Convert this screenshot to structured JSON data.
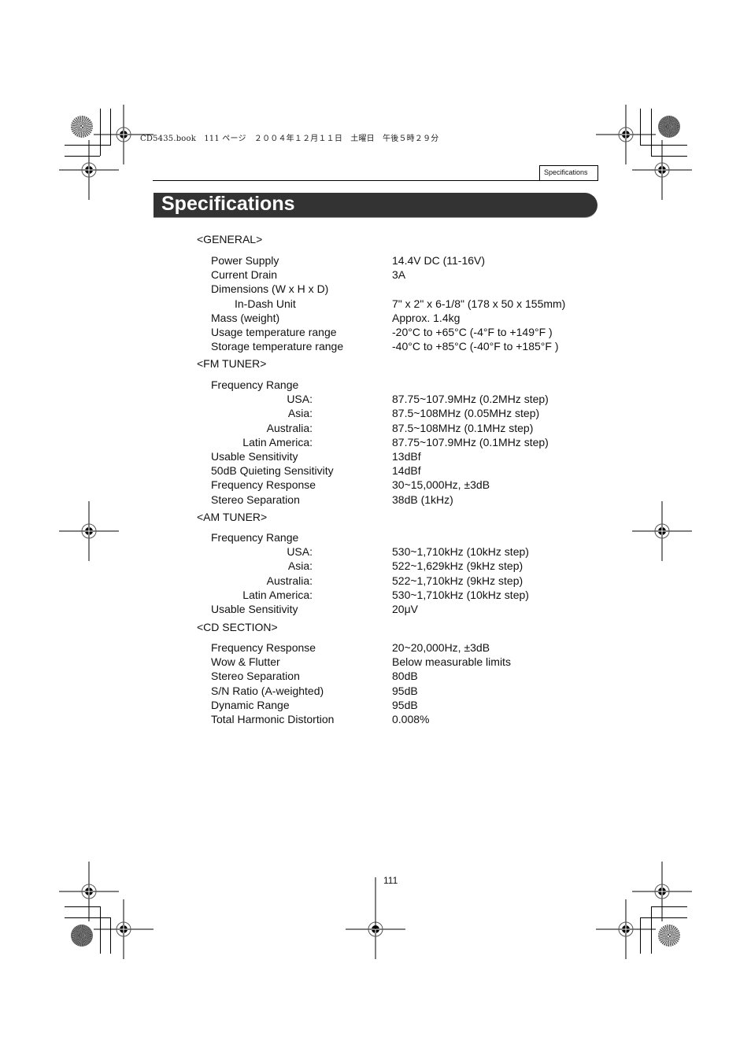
{
  "slug_text": "CD5435.book　111 ページ　２００４年１２月１１日　土曜日　午後５時２９分",
  "header_tab": "Specifications",
  "title": "Specifications",
  "page_number": "111",
  "sections": [
    {
      "heading": "<GENERAL>",
      "rows": [
        {
          "label": "Power Supply",
          "value": "14.4V DC (11-16V)"
        },
        {
          "label": "Current Drain",
          "value": "3A"
        },
        {
          "label": "Dimensions (W x H x D)",
          "value": ""
        },
        {
          "label": "In-Dash Unit",
          "value": "7\" x 2\" x 6-1/8\" (178 x 50 x 155mm)"
        },
        {
          "label": "Mass (weight)",
          "value": "Approx. 1.4kg"
        },
        {
          "label": "Usage temperature range",
          "value": "-20°C to +65°C (-4°F to +149°F )"
        },
        {
          "label": "Storage temperature range",
          "value": "-40°C to +85°C (-40°F to +185°F )"
        }
      ]
    },
    {
      "heading": "<FM TUNER>",
      "rows": [
        {
          "label": "Frequency Range",
          "value": ""
        },
        {
          "label": "USA:",
          "value": "87.75~107.9MHz (0.2MHz step)"
        },
        {
          "label": "Asia:",
          "value": "87.5~108MHz (0.05MHz step)"
        },
        {
          "label": "Australia:",
          "value": "87.5~108MHz (0.1MHz step)"
        },
        {
          "label": "Latin America:",
          "value": "87.75~107.9MHz (0.1MHz step)"
        },
        {
          "label": "Usable Sensitivity",
          "value": "13dBf"
        },
        {
          "label": "50dB Quieting Sensitivity",
          "value": "14dBf"
        },
        {
          "label": "Frequency Response",
          "value": "30~15,000Hz, ±3dB"
        },
        {
          "label": "Stereo Separation",
          "value": "38dB (1kHz)"
        }
      ]
    },
    {
      "heading": "<AM TUNER>",
      "rows": [
        {
          "label": "Frequency Range",
          "value": ""
        },
        {
          "label": "USA:",
          "value": "530~1,710kHz (10kHz step)"
        },
        {
          "label": "Asia:",
          "value": "522~1,629kHz (9kHz step)"
        },
        {
          "label": "Australia:",
          "value": "522~1,710kHz (9kHz step)"
        },
        {
          "label": "Latin America:",
          "value": "530~1,710kHz (10kHz step)"
        },
        {
          "label": "Usable Sensitivity",
          "value": "20μV"
        }
      ]
    },
    {
      "heading": "<CD SECTION>",
      "rows": [
        {
          "label": "Frequency Response",
          "value": "20~20,000Hz, ±3dB"
        },
        {
          "label": "Wow & Flutter",
          "value": "Below measurable limits"
        },
        {
          "label": "Stereo Separation",
          "value": "80dB"
        },
        {
          "label": "S/N Ratio (A-weighted)",
          "value": "95dB"
        },
        {
          "label": "Dynamic Range",
          "value": "95dB"
        },
        {
          "label": "Total Harmonic Distortion",
          "value": "0.008%"
        }
      ]
    }
  ]
}
